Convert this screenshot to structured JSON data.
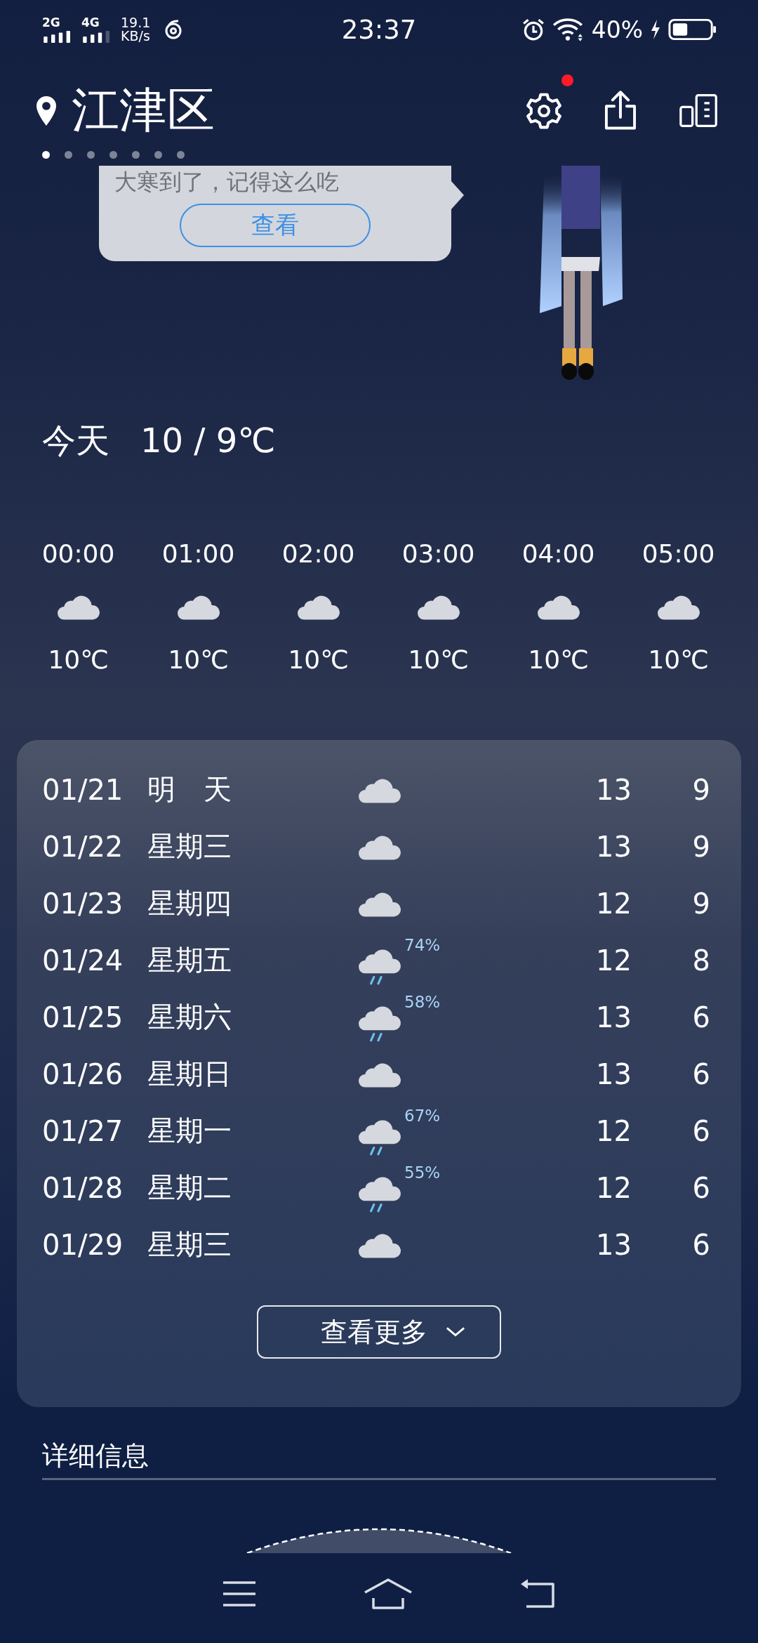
{
  "status_bar": {
    "sim1": "2G",
    "sim2": "4G",
    "speed": "19.1",
    "speed_unit": "KB/s",
    "time": "23:37",
    "battery": "40%"
  },
  "header": {
    "location": "江津区",
    "settings_badge": true,
    "pages": [
      {
        "selected": true
      },
      {
        "selected": false
      },
      {
        "selected": false
      },
      {
        "selected": false
      },
      {
        "selected": false
      },
      {
        "selected": false
      },
      {
        "selected": false
      }
    ]
  },
  "tip": {
    "text": "大寒到了，记得这么吃",
    "button": "查看"
  },
  "today": {
    "label": "今天",
    "range": "10 / 9℃"
  },
  "hourly": [
    {
      "time": "00:00",
      "kind": "cloudy",
      "temp": "10℃"
    },
    {
      "time": "01:00",
      "kind": "cloudy",
      "temp": "10℃"
    },
    {
      "time": "02:00",
      "kind": "cloudy",
      "temp": "10℃"
    },
    {
      "time": "03:00",
      "kind": "cloudy",
      "temp": "10℃"
    },
    {
      "time": "04:00",
      "kind": "cloudy",
      "temp": "10℃"
    },
    {
      "time": "05:00",
      "kind": "cloudy",
      "temp": "10℃"
    }
  ],
  "daily": [
    {
      "date": "01/21",
      "day": "明　天",
      "kind": "cloudy",
      "high": "13",
      "low": "9"
    },
    {
      "date": "01/22",
      "day": "星期三",
      "kind": "cloudy",
      "high": "13",
      "low": "9"
    },
    {
      "date": "01/23",
      "day": "星期四",
      "kind": "cloudy",
      "high": "12",
      "low": "9"
    },
    {
      "date": "01/24",
      "day": "星期五",
      "kind": "rain",
      "chance": "74%",
      "high": "12",
      "low": "8"
    },
    {
      "date": "01/25",
      "day": "星期六",
      "kind": "rain",
      "chance": "58%",
      "high": "13",
      "low": "6"
    },
    {
      "date": "01/26",
      "day": "星期日",
      "kind": "cloudy",
      "high": "13",
      "low": "6"
    },
    {
      "date": "01/27",
      "day": "星期一",
      "kind": "rain",
      "chance": "67%",
      "high": "12",
      "low": "6"
    },
    {
      "date": "01/28",
      "day": "星期二",
      "kind": "rain",
      "chance": "55%",
      "high": "12",
      "low": "6"
    },
    {
      "date": "01/29",
      "day": "星期三",
      "kind": "cloudy",
      "high": "13",
      "low": "6"
    }
  ],
  "more_button": "查看更多",
  "details": {
    "title": "详细信息"
  }
}
